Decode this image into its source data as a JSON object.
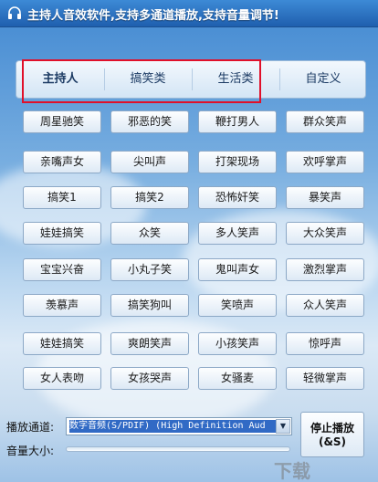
{
  "window": {
    "title": "主持人音效软件,支持多通道播放,支持音量调节!"
  },
  "tabs": [
    {
      "label": "主持人"
    },
    {
      "label": "搞笑类"
    },
    {
      "label": "生活类"
    },
    {
      "label": "自定义"
    }
  ],
  "sound_buttons": [
    [
      "周星驰笑",
      "邪恶的笑",
      "鞭打男人",
      "群众笑声"
    ],
    [
      "亲嘴声女",
      "尖叫声",
      "打架现场",
      "欢呼掌声"
    ],
    [
      "搞笑1",
      "搞笑2",
      "恐怖奸笑",
      "暴笑声"
    ],
    [
      "娃娃搞笑",
      "众笑",
      "多人笑声",
      "大众笑声"
    ],
    [
      "宝宝兴奋",
      "小丸子笑",
      "鬼叫声女",
      "激烈掌声"
    ],
    [
      "羡慕声",
      "搞笑狗叫",
      "笑喷声",
      "众人笑声"
    ],
    [
      "娃娃搞笑",
      "爽朗笑声",
      "小孩笑声",
      "惊呼声"
    ],
    [
      "女人表吻",
      "女孩哭声",
      "女骚麦",
      "轻微掌声"
    ]
  ],
  "controls": {
    "channel_label": "播放通道:",
    "channel_value": "数字音频(S/PDIF) (High Definition Aud",
    "volume_label": "音量大小:",
    "stop_label": "停止播放",
    "stop_hotkey": "(&S)"
  },
  "watermark": "下载"
}
